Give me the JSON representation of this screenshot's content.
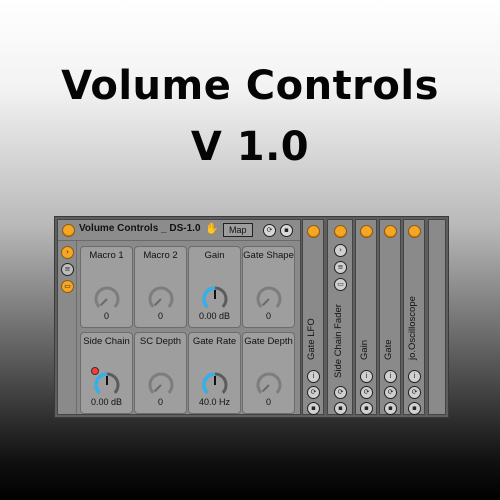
{
  "hero": {
    "line1": "Volume Controls",
    "line2": "V 1.0"
  },
  "device": {
    "title": "Volume Controls _ DS-1.0",
    "map_label": "Map",
    "macros": [
      {
        "label": "Macro 1",
        "value": "0",
        "level": 0.0
      },
      {
        "label": "Macro 2",
        "value": "0",
        "level": 0.0
      },
      {
        "label": "Gain",
        "value": "0.00 dB",
        "level": 0.5
      },
      {
        "label": "Gate Shape",
        "value": "0",
        "level": 0.0
      },
      {
        "label": "Side Chain",
        "value": "0.00 dB",
        "level": 0.5
      },
      {
        "label": "SC Depth",
        "value": "0",
        "level": 0.0
      },
      {
        "label": "Gate Rate",
        "value": "40.0 Hz",
        "level": 0.5
      },
      {
        "label": "Gate Depth",
        "value": "0",
        "level": 0.0
      }
    ]
  },
  "chain_devices": [
    {
      "label": "Gate LFO"
    },
    {
      "label": "Side Chain Fader"
    },
    {
      "label": "Gain"
    },
    {
      "label": "Gate"
    },
    {
      "label": "jo.Oscilloscope"
    }
  ],
  "colors": {
    "accent": "#f5a623",
    "knob_active": "#29b5f5",
    "panel": "#8a8a8a",
    "mod_dot": "#ff3b3b"
  },
  "icons": [
    "power-icon",
    "hand-icon",
    "hot-swap-icon",
    "save-icon",
    "chevron-icon",
    "list-icon",
    "keyboard-icon"
  ]
}
